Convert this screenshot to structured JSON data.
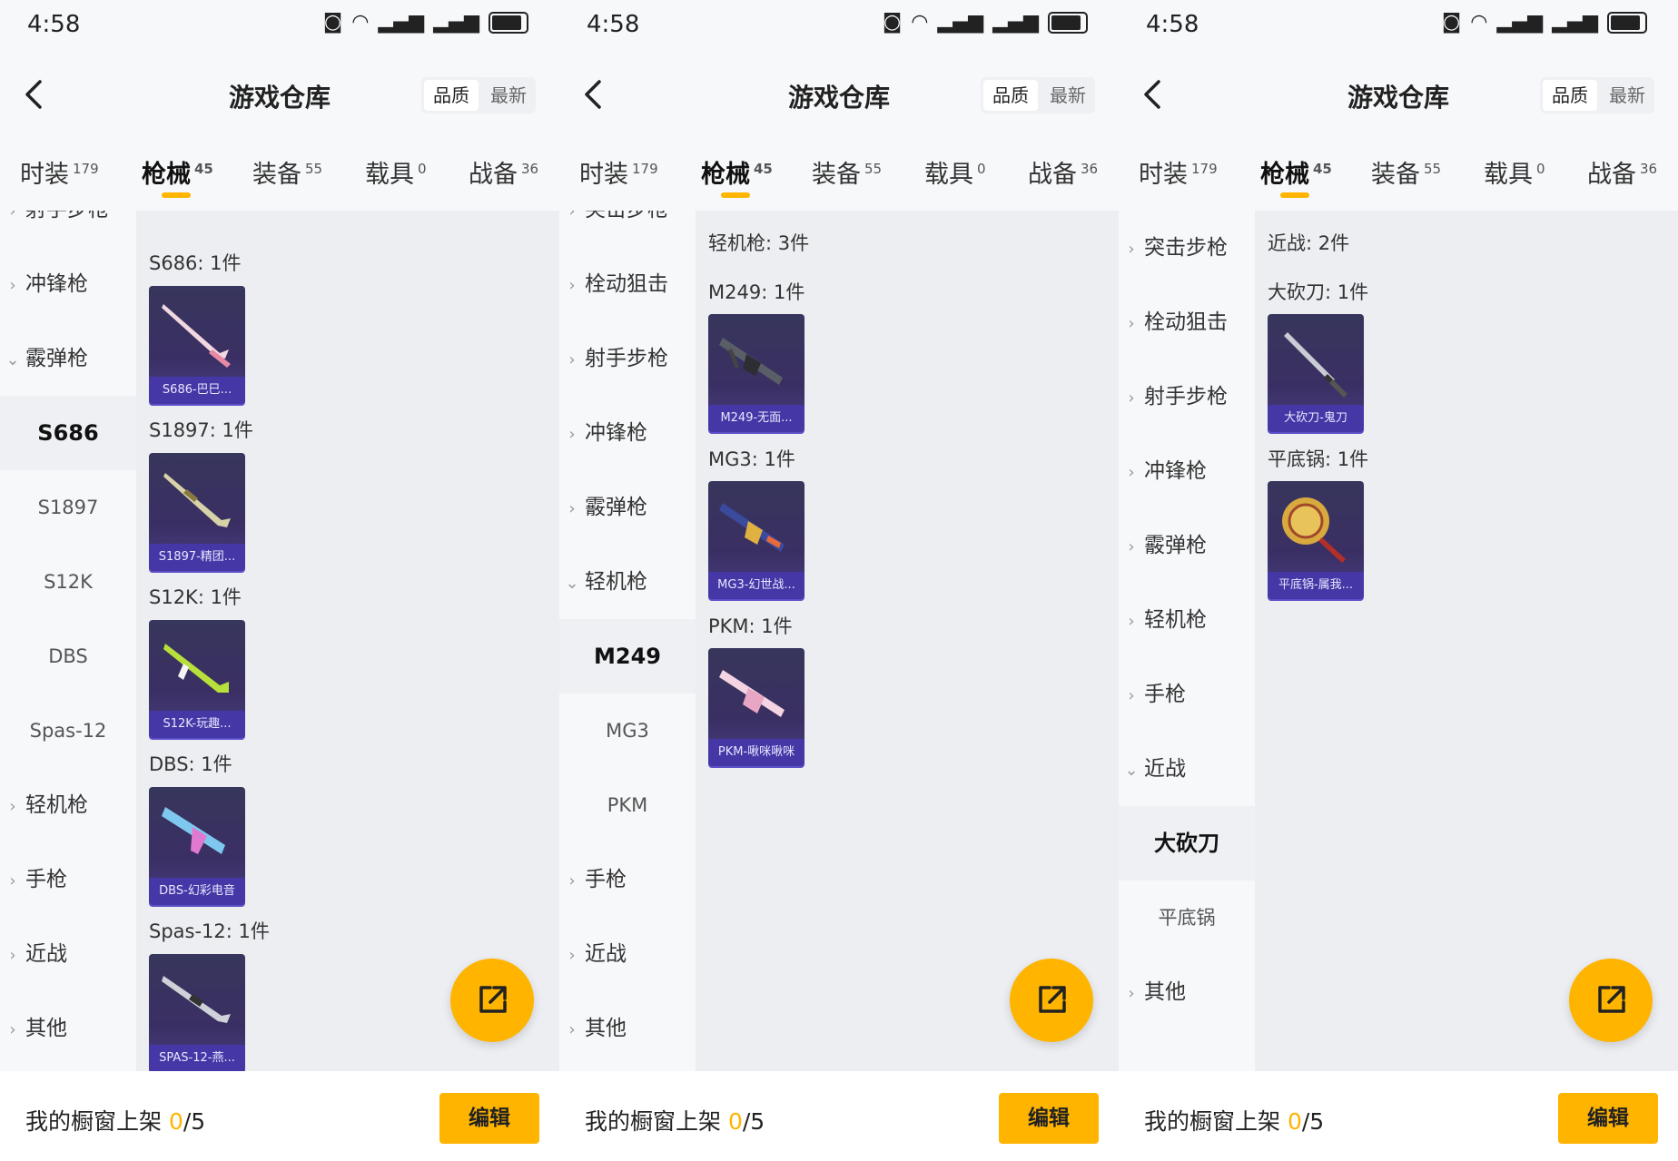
{
  "status": {
    "time": "4:58",
    "net": "4G"
  },
  "header": {
    "title": "游戏仓库",
    "sort_quality": "品质",
    "sort_latest": "最新"
  },
  "tabs": [
    {
      "label": "时装",
      "count": "179"
    },
    {
      "label": "枪械",
      "count": "45"
    },
    {
      "label": "装备",
      "count": "55"
    },
    {
      "label": "载具",
      "count": "0"
    },
    {
      "label": "战备",
      "count": "36"
    }
  ],
  "footer": {
    "label": "我的橱窗上架 ",
    "count": "0",
    "total": "/5",
    "edit": "编辑"
  },
  "colors": {
    "accent": "#ffb400",
    "card_bg": "#3a2f63",
    "card_label": "#4538a6"
  },
  "panels": [
    {
      "sidebar": [
        {
          "label": "射手步枪",
          "kind": "cat"
        },
        {
          "label": "冲锋枪",
          "kind": "cat"
        },
        {
          "label": "霰弹枪",
          "kind": "cat-open"
        },
        {
          "label": "S686",
          "kind": "sel"
        },
        {
          "label": "S1897",
          "kind": "sub"
        },
        {
          "label": "S12K",
          "kind": "sub"
        },
        {
          "label": "DBS",
          "kind": "sub"
        },
        {
          "label": "Spas-12",
          "kind": "sub"
        },
        {
          "label": "轻机枪",
          "kind": "cat"
        },
        {
          "label": "手枪",
          "kind": "cat"
        },
        {
          "label": "近战",
          "kind": "cat"
        },
        {
          "label": "其他",
          "kind": "cat"
        }
      ],
      "content": [
        {
          "title": "S686: 1件",
          "item": "S686-巴巳...",
          "icon": "shotgun-pink-icon"
        },
        {
          "title": "S1897: 1件",
          "item": "S1897-精团...",
          "icon": "shotgun-gold-icon"
        },
        {
          "title": "S12K: 1件",
          "item": "S12K-玩趣...",
          "icon": "shotgun-green-icon"
        },
        {
          "title": "DBS: 1件",
          "item": "DBS-幻彩电音",
          "icon": "shotgun-blue-icon"
        },
        {
          "title": "Spas-12: 1件",
          "item": "SPAS-12-燕...",
          "icon": "shotgun-grey-icon"
        }
      ]
    },
    {
      "sidebar": [
        {
          "label": "突击步枪",
          "kind": "cat"
        },
        {
          "label": "栓动狙击",
          "kind": "cat"
        },
        {
          "label": "射手步枪",
          "kind": "cat"
        },
        {
          "label": "冲锋枪",
          "kind": "cat"
        },
        {
          "label": "霰弹枪",
          "kind": "cat"
        },
        {
          "label": "轻机枪",
          "kind": "cat-open"
        },
        {
          "label": "M249",
          "kind": "sel"
        },
        {
          "label": "MG3",
          "kind": "sub"
        },
        {
          "label": "PKM",
          "kind": "sub"
        },
        {
          "label": "手枪",
          "kind": "cat"
        },
        {
          "label": "近战",
          "kind": "cat"
        },
        {
          "label": "其他",
          "kind": "cat"
        }
      ],
      "section": "轻机枪: 3件",
      "content": [
        {
          "title": "M249: 1件",
          "item": "M249-无面...",
          "icon": "lmg-dark-icon"
        },
        {
          "title": "MG3: 1件",
          "item": "MG3-幻世战...",
          "icon": "lmg-blue-icon"
        },
        {
          "title": "PKM: 1件",
          "item": "PKM-啾咪啾咪",
          "icon": "lmg-pink-icon"
        }
      ]
    },
    {
      "sidebar": [
        {
          "label": "突击步枪",
          "kind": "cat"
        },
        {
          "label": "栓动狙击",
          "kind": "cat"
        },
        {
          "label": "射手步枪",
          "kind": "cat"
        },
        {
          "label": "冲锋枪",
          "kind": "cat"
        },
        {
          "label": "霰弹枪",
          "kind": "cat"
        },
        {
          "label": "轻机枪",
          "kind": "cat"
        },
        {
          "label": "手枪",
          "kind": "cat"
        },
        {
          "label": "近战",
          "kind": "cat-open"
        },
        {
          "label": "大砍刀",
          "kind": "sel"
        },
        {
          "label": "平底锅",
          "kind": "sub"
        },
        {
          "label": "其他",
          "kind": "cat"
        }
      ],
      "section": "近战: 2件",
      "content": [
        {
          "title": "大砍刀: 1件",
          "item": "大砍刀-鬼刀",
          "icon": "machete-icon"
        },
        {
          "title": "平底锅: 1件",
          "item": "平底锅-属我...",
          "icon": "pan-icon"
        }
      ]
    }
  ]
}
